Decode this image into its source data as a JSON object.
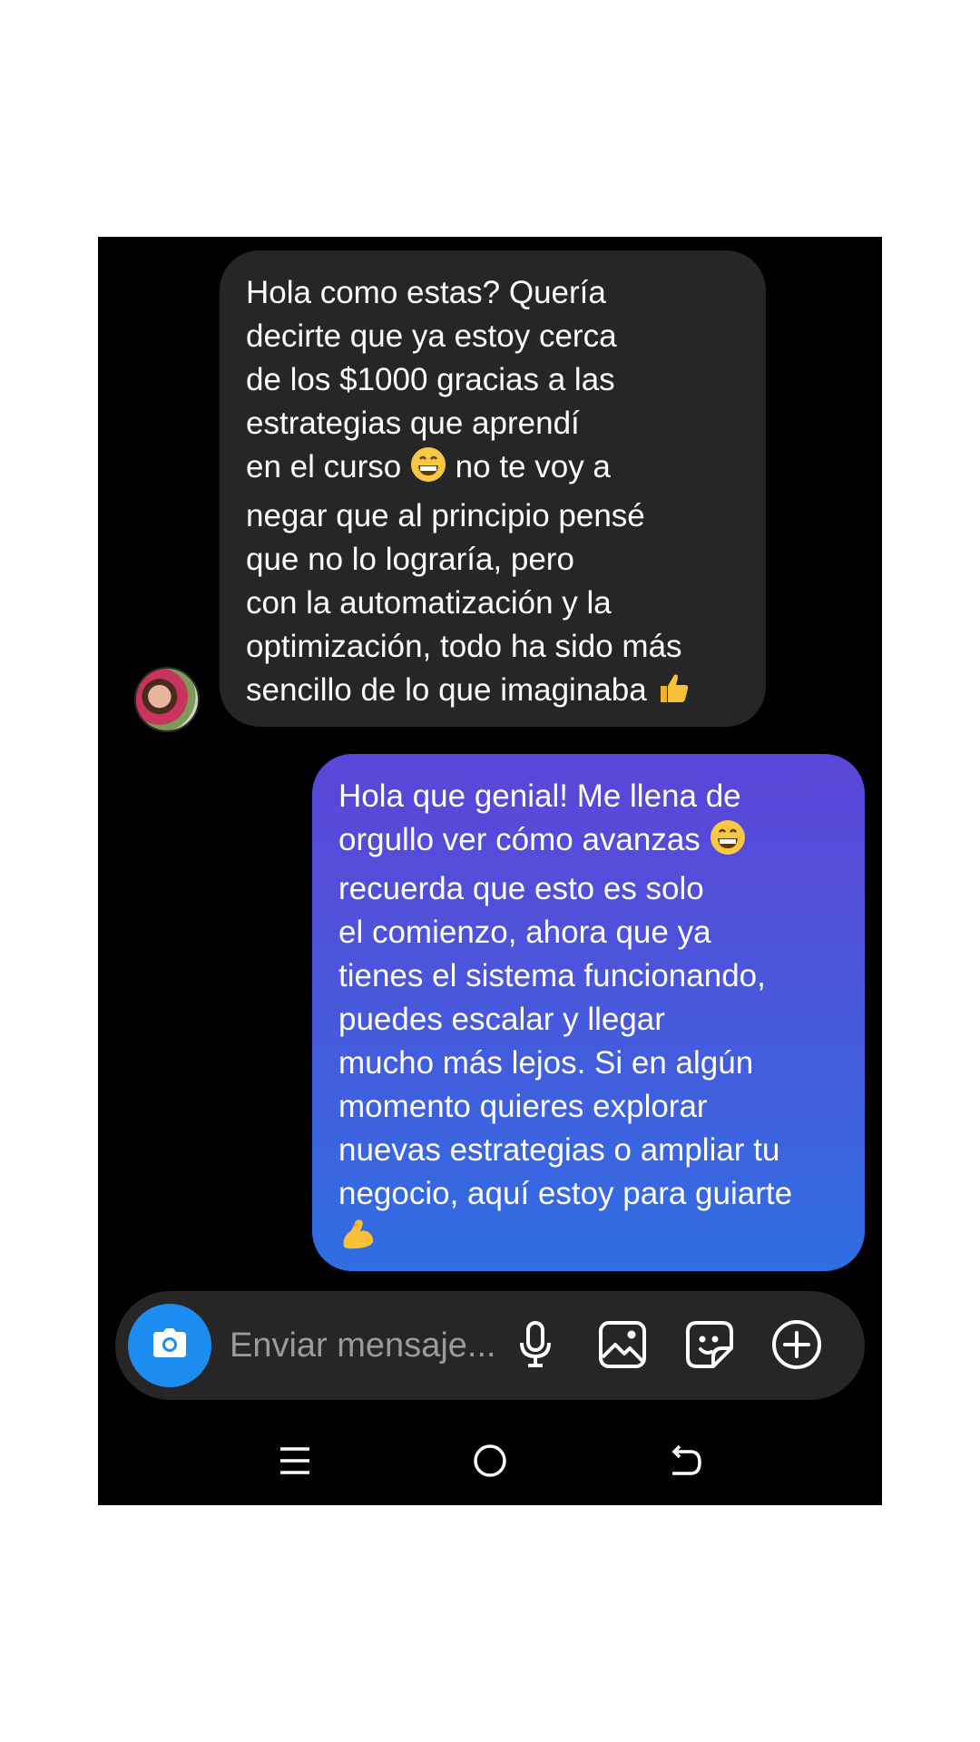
{
  "conversation": {
    "incoming": {
      "segments": [
        "Hola como estas? Quería\ndecirte que ya estoy cerca\nde los $1000 gracias a las\nestrategias que aprendí\nen el curso ",
        "  no te voy a\nnegar que al principio pensé\nque no lo lograría, pero\ncon la automatización y la\noptimización, todo ha sido más\nsencillo de lo que imaginaba "
      ],
      "emojis": [
        "grinning-face-emoji",
        "thumbs-up-emoji"
      ]
    },
    "outgoing": {
      "segments": [
        "Hola que genial! Me llena de\norgullo ver cómo avanzas ",
        "\nrecuerda que esto es solo\nel comienzo, ahora que ya\ntienes el sistema funcionando,\npuedes escalar y llegar\nmucho más lejos. Si en algún\nmomento quieres explorar\nnuevas estrategias o ampliar tu\nnegocio, aquí estoy para guiarte\n"
      ],
      "emojis": [
        "grinning-face-emoji",
        "flexed-biceps-emoji"
      ],
      "gradient": [
        "#5b45d8",
        "#2f6ee3"
      ]
    }
  },
  "composer": {
    "placeholder": "Enviar mensaje...",
    "icons": [
      "camera-icon",
      "microphone-icon",
      "gallery-icon",
      "sticker-icon",
      "plus-circle-icon"
    ],
    "accent": "#1d8cf0"
  },
  "navbar": {
    "icons": [
      "menu-icon",
      "home-icon",
      "back-icon"
    ]
  }
}
